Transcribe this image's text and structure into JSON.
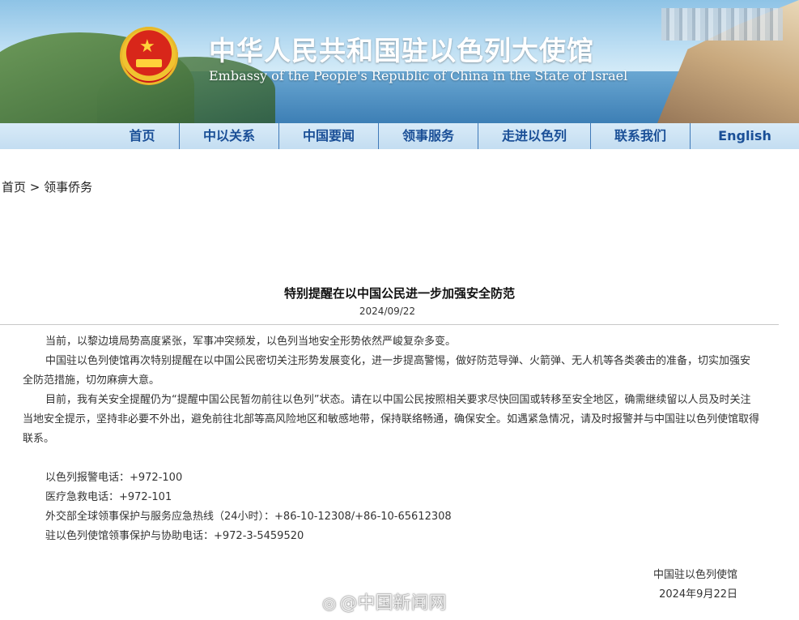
{
  "header": {
    "title_cn": "中华人民共和国驻以色列大使馆",
    "title_en": "Embassy of the People's Republic of China in the State of Israel"
  },
  "nav": {
    "items": [
      {
        "label": "首页"
      },
      {
        "label": "中以关系"
      },
      {
        "label": "中国要闻"
      },
      {
        "label": "领事服务"
      },
      {
        "label": "走进以色列"
      },
      {
        "label": "联系我们"
      },
      {
        "label": "English"
      }
    ]
  },
  "breadcrumb": {
    "home": "首页",
    "separator": " > ",
    "current": "领事侨务"
  },
  "article": {
    "title": "特别提醒在以中国公民进一步加强安全防范",
    "date": "2024/09/22",
    "paragraphs": [
      "当前，以黎边境局势高度紧张，军事冲突频发，以色列当地安全形势依然严峻复杂多变。",
      "中国驻以色列使馆再次特别提醒在以中国公民密切关注形势发展变化，进一步提高警惕，做好防范导弹、火箭弹、无人机等各类袭击的准备，切实加强安全防范措施，切勿麻痹大意。",
      "目前，我有关安全提醒仍为“提醒中国公民暂勿前往以色列”状态。请在以中国公民按照相关要求尽快回国或转移至安全地区，确需继续留以人员及时关注当地安全提示，坚持非必要不外出，避免前往北部等高风险地区和敏感地带，保持联络畅通，确保安全。如遇紧急情况，请及时报警并与中国驻以色列使馆取得联系。"
    ],
    "contacts": [
      "以色列报警电话：+972-100",
      "医疗急救电话：+972-101",
      "外交部全球领事保护与服务应急热线（24小时）：+86-10-12308/+86-10-65612308",
      "驻以色列使馆领事保护与协助电话：+972-3-5459520"
    ],
    "signature": "中国驻以色列使馆",
    "signature_date": "2024年9月22日"
  },
  "watermark": {
    "text": "@中国新闻网",
    "icon": "weibo-icon"
  },
  "colors": {
    "nav_text": "#1a4f97",
    "nav_bg": "#d9ebf8"
  }
}
